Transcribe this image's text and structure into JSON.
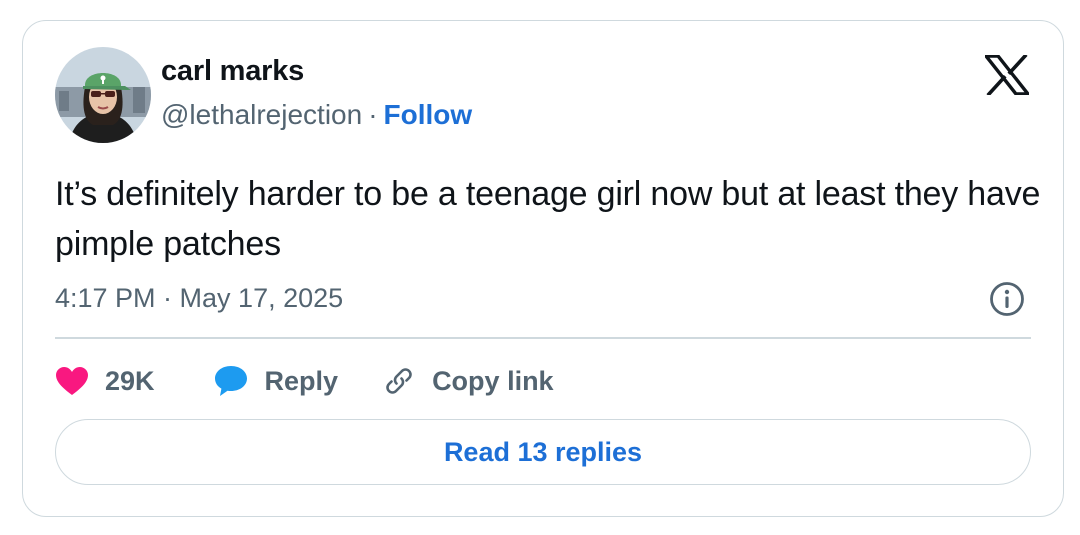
{
  "author": {
    "name": "carl marks",
    "handle": "@lethalrejection",
    "separator": "·",
    "follow_label": "Follow"
  },
  "platform_logo": "x-logo-icon",
  "tweet": {
    "text": "It’s definitely harder to be a teenage girl now but at least they have pimple patches",
    "timestamp": "4:17 PM · May 17, 2025"
  },
  "actions": {
    "like_count": "29K",
    "reply_label": "Reply",
    "copy_link_label": "Copy link"
  },
  "read_replies_label": "Read 13 replies",
  "colors": {
    "link_blue": "#1d6fd6",
    "heart_pink": "#f91880",
    "reply_blue": "#1d9bf0",
    "secondary_text": "#536471",
    "border": "#cfd9de"
  }
}
